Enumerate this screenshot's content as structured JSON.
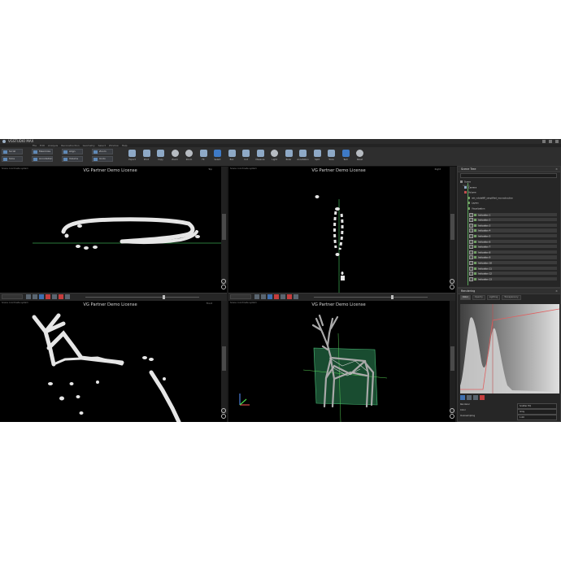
{
  "app": {
    "title": "VGSTUDIO MAX",
    "menu": [
      "File",
      "Edit",
      "Analysis",
      "Reconstruction",
      "Geometry",
      "Select",
      "Window",
      "Help"
    ]
  },
  "ribbon": {
    "left_buttons": [
      {
        "label": "Scroll"
      },
      {
        "label": "Slice"
      },
      {
        "label": "Maximize"
      },
      {
        "label": "Annotation"
      },
      {
        "label": "Align"
      },
      {
        "label": "Volume"
      },
      {
        "label": "Zoom"
      },
      {
        "label": "Undo"
      }
    ],
    "tools": [
      {
        "label": "Export",
        "icon": "export-icon"
      },
      {
        "label": "Print",
        "icon": "print-icon"
      },
      {
        "label": "Copy",
        "icon": "copy-icon"
      },
      {
        "label": "Zoom",
        "icon": "zoom-in-icon"
      },
      {
        "label": "Zoom",
        "icon": "zoom-out-icon"
      },
      {
        "label": "Fit",
        "icon": "fit-icon"
      },
      {
        "label": "Select",
        "icon": "select-icon"
      },
      {
        "label": "Box",
        "icon": "box-icon"
      },
      {
        "label": "Cut",
        "icon": "cut-icon"
      },
      {
        "label": "Measure",
        "icon": "measure-icon"
      },
      {
        "label": "Light",
        "icon": "light-icon"
      },
      {
        "label": "Ruler",
        "icon": "ruler-icon"
      },
      {
        "label": "Annotation",
        "icon": "annotation-icon"
      },
      {
        "label": "Split",
        "icon": "split-icon"
      },
      {
        "label": "Tools",
        "icon": "tools-icon"
      },
      {
        "label": "Text",
        "icon": "text-icon"
      },
      {
        "label": "Reset",
        "icon": "reset-icon"
      }
    ]
  },
  "viewports": {
    "watermark": "VG Partner Demo License",
    "top_left": {
      "tag": "Top",
      "coord": "Scene coordinate system"
    },
    "top_right": {
      "tag": "Right",
      "coord": "Scene coordinate system"
    },
    "bottom_left": {
      "tag": "Front",
      "coord": "Scene coordinate system"
    },
    "bottom_right": {
      "tag": "",
      "coord": "Scene coordinate system"
    }
  },
  "scene_tree": {
    "title": "Scene Tree",
    "search_placeholder": "Search",
    "rows": [
      {
        "label": "Scene",
        "icon": "gray"
      },
      {
        "label": "Camera",
        "icon": "cam"
      },
      {
        "label": "Volume",
        "icon": "box"
      },
      {
        "label": "reh_rotateNR_simplified_reconstruction",
        "icon": "green"
      },
      {
        "label": "Layers",
        "icon": "green"
      },
      {
        "label": "Visualization",
        "icon": "green"
      },
      {
        "label": "Indication 1",
        "icon": "green",
        "selected": true
      },
      {
        "label": "Indication 2",
        "icon": "green",
        "selected": true
      },
      {
        "label": "Indication 3",
        "icon": "green",
        "selected": true
      },
      {
        "label": "Indication 4",
        "icon": "green",
        "selected": true
      },
      {
        "label": "Indication 5",
        "icon": "green",
        "selected": true
      },
      {
        "label": "Indication 6",
        "icon": "green",
        "selected": true
      },
      {
        "label": "Indication 7",
        "icon": "green",
        "selected": true
      },
      {
        "label": "Indication 8",
        "icon": "green",
        "selected": true
      },
      {
        "label": "Indication 9",
        "icon": "green",
        "selected": true
      },
      {
        "label": "Indication 10",
        "icon": "green",
        "selected": true
      },
      {
        "label": "Indication 11",
        "icon": "green",
        "selected": true
      },
      {
        "label": "Indication 12",
        "icon": "green",
        "selected": true
      },
      {
        "label": "Indication 13",
        "icon": "green",
        "selected": true
      }
    ]
  },
  "rendering": {
    "title": "Rendering",
    "tabs": [
      "Color",
      "Opacity",
      "Lighting",
      "Transparency"
    ],
    "props": [
      {
        "label": "Renderer",
        "value": "Scatter HQ"
      },
      {
        "label": "Color",
        "value": "Gray"
      },
      {
        "label": "Oversampling",
        "value": "1.00"
      }
    ]
  },
  "colors": {
    "mesh_green": "#2e8b57",
    "accent_blue": "#3e7ac6",
    "tree_green": "#6f9e63"
  }
}
